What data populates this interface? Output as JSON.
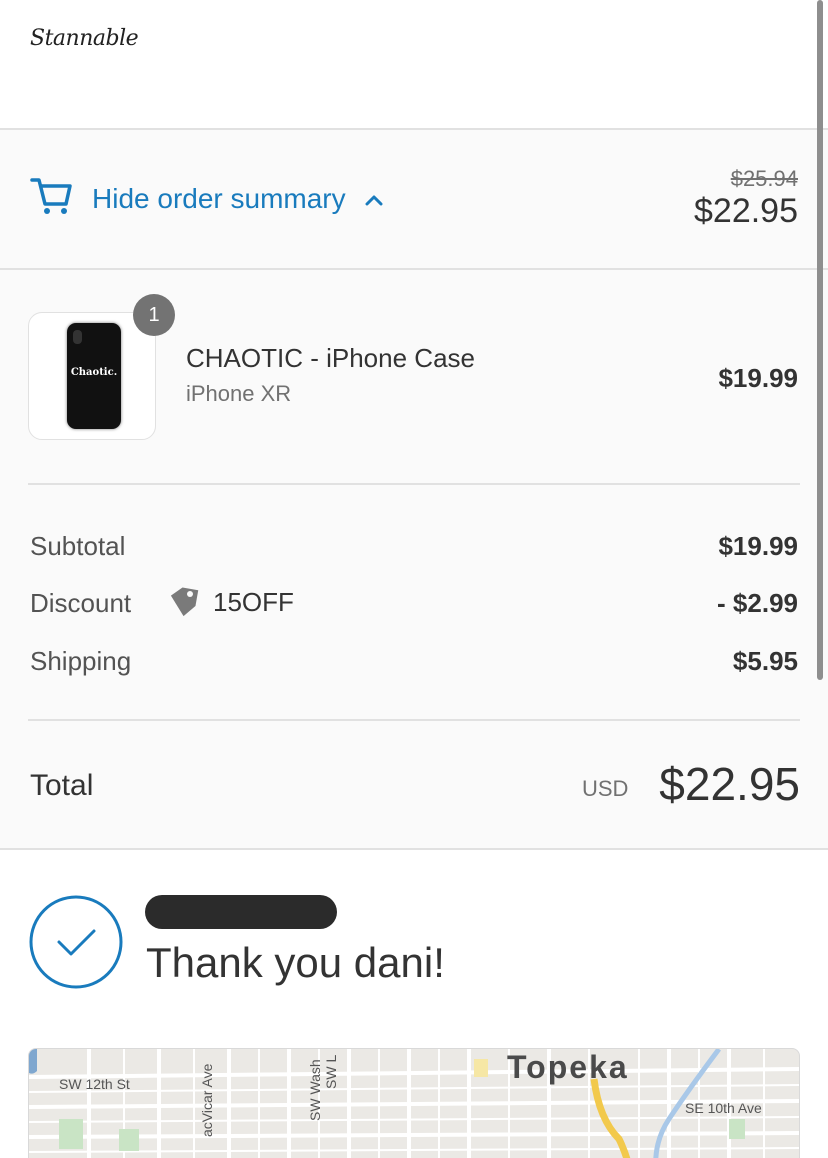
{
  "header": {
    "logo_text": "Stannable"
  },
  "summary_toggle": {
    "label": "Hide order summary",
    "icon": "cart-icon",
    "expand_icon": "chevron-up-icon",
    "original_price": "$25.94",
    "current_price": "$22.95",
    "accent_color": "#197bbd"
  },
  "line_item": {
    "quantity": "1",
    "thumbnail_text": "Chaotic.",
    "title": "CHAOTIC - iPhone Case",
    "variant": "iPhone XR",
    "price": "$19.99"
  },
  "totals": {
    "subtotal_label": "Subtotal",
    "subtotal_value": "$19.99",
    "discount_label": "Discount",
    "discount_icon": "tag-icon",
    "discount_code": "15OFF",
    "discount_value": "- $2.99",
    "shipping_label": "Shipping",
    "shipping_value": "$5.95",
    "total_label": "Total",
    "currency": "USD",
    "total_value": "$22.95"
  },
  "confirmation": {
    "icon": "checkmark-circle-icon",
    "thank_you": "Thank you dani!"
  },
  "map": {
    "city": "Topeka",
    "streets": [
      "SW 12th St",
      "acVicar Ave",
      "SW Wash",
      "SW L",
      "SE 10th Ave"
    ]
  }
}
